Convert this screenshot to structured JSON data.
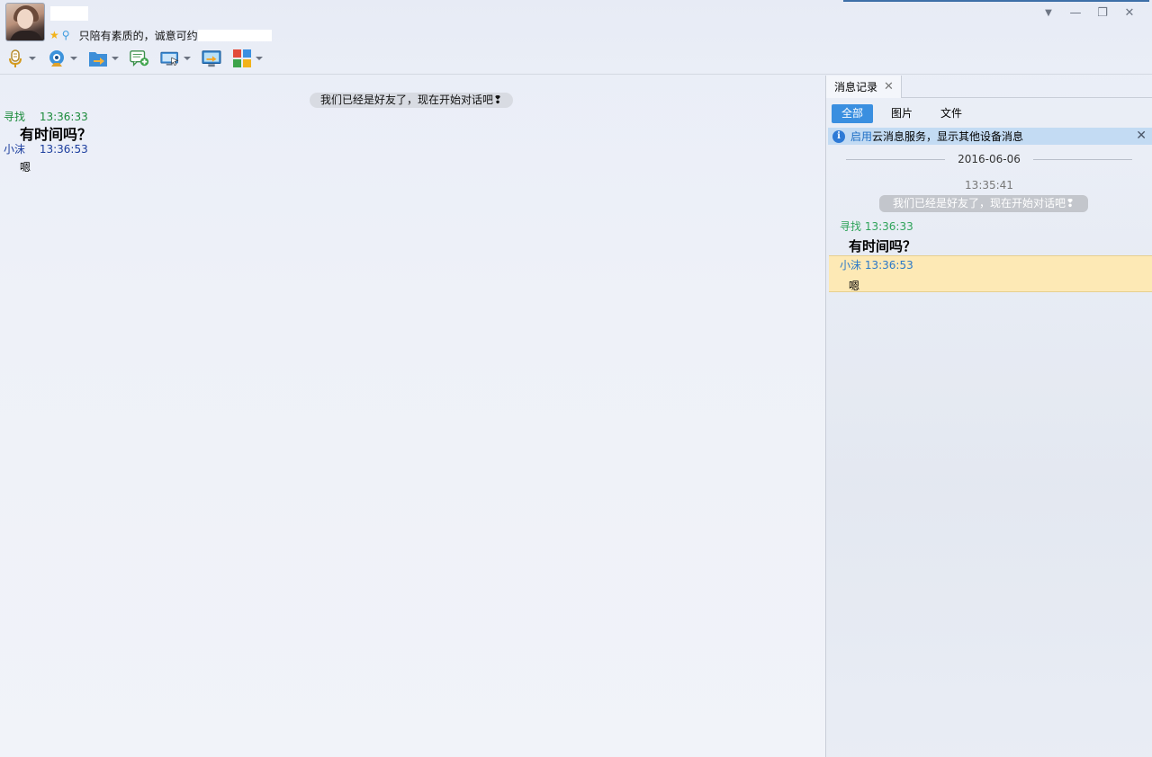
{
  "header": {
    "signature": "只陪有素质的，诚意可约",
    "toolbar": [
      {
        "name": "voice-call",
        "icon": "microphone-icon",
        "has_menu": true
      },
      {
        "name": "video-call",
        "icon": "webcam-icon",
        "has_menu": true
      },
      {
        "name": "send-file",
        "icon": "folder-send-icon",
        "has_menu": true
      },
      {
        "name": "create-discussion",
        "icon": "chat-add-icon",
        "has_menu": false
      },
      {
        "name": "remote-assist",
        "icon": "remote-desktop-icon",
        "has_menu": true
      },
      {
        "name": "share-screen",
        "icon": "screen-share-icon",
        "has_menu": false
      },
      {
        "name": "apps",
        "icon": "apps-grid-icon",
        "has_menu": true
      }
    ],
    "window_controls": {
      "menu": "▼",
      "minimize": "—",
      "restore": "❐",
      "close": "✕"
    }
  },
  "chat": {
    "system_notice": "我们已经是好友了，现在开始对话吧❢",
    "messages": [
      {
        "sender": "寻找",
        "time": "13:36:33",
        "text": "有时间吗？",
        "sender_color": "#1a8a3a",
        "large": true
      },
      {
        "sender": "小沫",
        "time": "13:36:53",
        "text": "嗯",
        "sender_color": "#1b3d9e",
        "large": false
      }
    ]
  },
  "history": {
    "tab_label": "消息记录",
    "filters": [
      "全部",
      "图片",
      "文件"
    ],
    "active_filter": 0,
    "info_link": "启用",
    "info_text": "云消息服务，显示其他设备消息",
    "date": "2016-06-06",
    "first_time": "13:35:41",
    "system_notice": "我们已经是好友了，现在开始对话吧❢",
    "messages": [
      {
        "sender": "寻找",
        "time": "13:36:33",
        "text": "有时间吗？",
        "color": "#2fa35a"
      },
      {
        "sender": "小沫",
        "time": "13:36:53",
        "text": "嗯",
        "color": "#2a78c8",
        "highlighted": true
      }
    ]
  },
  "colors": {
    "accent": "#3a8fe0",
    "highlight": "#fde9b5",
    "info_bar": "#c3dbf3"
  }
}
